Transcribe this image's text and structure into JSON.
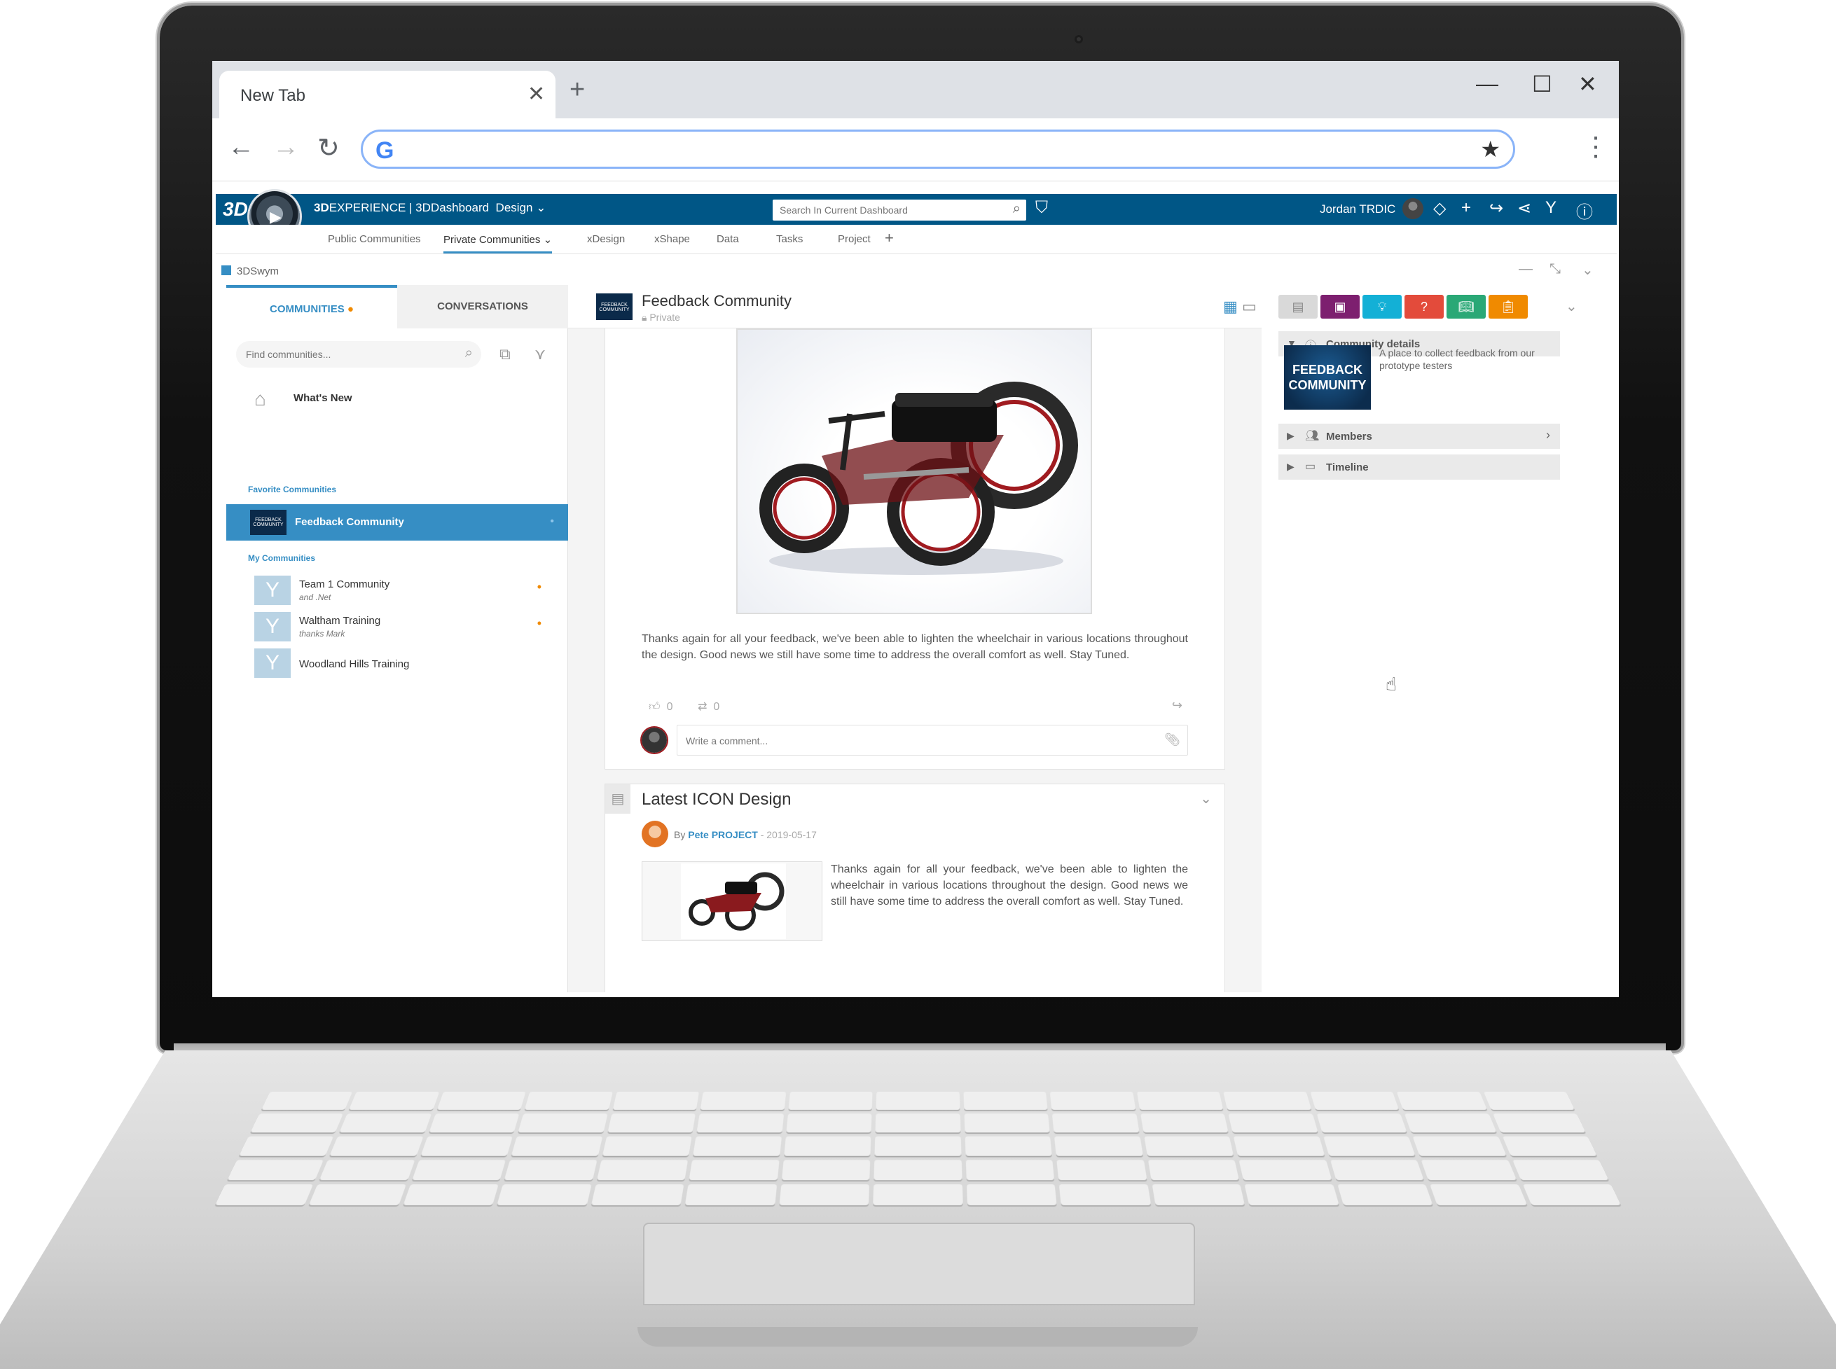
{
  "browser": {
    "tab_title": "New Tab",
    "tab_close": "✕",
    "new_tab": "+",
    "omnibox_value": "",
    "omnibox_logo": "G"
  },
  "xbar": {
    "brand_bold": "3D",
    "brand_text": "EXPERIENCE | 3DDashboard",
    "brand_app": "Design",
    "search_placeholder": "Search In Current Dashboard",
    "user_name": "Jordan TRDIC"
  },
  "dashboard_tabs": [
    {
      "label": "Public Communities"
    },
    {
      "label": "Private Communities"
    },
    {
      "label": "xDesign"
    },
    {
      "label": "xShape"
    },
    {
      "label": "Data"
    },
    {
      "label": "Tasks"
    },
    {
      "label": "Project"
    }
  ],
  "widget": {
    "title": "3DSwym"
  },
  "sidebar": {
    "tab_communities": "COMMUNITIES",
    "tab_conversations": "CONVERSATIONS",
    "find_placeholder": "Find communities...",
    "whats_new": "What's New",
    "favorites_label": "Favorite Communities",
    "favorite": {
      "name": "Feedback Community",
      "thumb_text": "FEEDBACK COMMUNITY"
    },
    "my_label": "My Communities",
    "communities": [
      {
        "name": "Team 1 Community",
        "sub": "and .Net"
      },
      {
        "name": "Waltham Training",
        "sub": "thanks Mark"
      },
      {
        "name": "Woodland Hills Training",
        "sub": ""
      }
    ]
  },
  "feed": {
    "title": "Feedback Community",
    "privacy": "Private",
    "thumb_text": "FEEDBACK COMMUNITY",
    "post1": {
      "text": "Thanks again for all your feedback, we've been able to lighten the wheelchair in various locations throughout the design. Good news we still have some time to address the overall comfort as well. Stay Tuned.",
      "likes": "0",
      "reposts": "0",
      "comment_placeholder": "Write a comment..."
    },
    "post2": {
      "title": "Latest ICON Design",
      "by": "By",
      "author": "Pete PROJECT",
      "date": "- 2019-05-17",
      "text": "Thanks again for all your feedback, we've been able to lighten the wheelchair in various locations throughout the design. Good news we still have some time to address the overall comfort as well. Stay Tuned."
    }
  },
  "right_panel": {
    "tiles": [
      {
        "color": "#d9d9d9"
      },
      {
        "color": "#7d1f6f"
      },
      {
        "color": "#13b0d6"
      },
      {
        "color": "#e34b3b"
      },
      {
        "color": "#2aa876"
      },
      {
        "color": "#f08a00"
      }
    ],
    "community_details": "Community details",
    "logo_text": "FEEDBACK COMMUNITY",
    "description": "A place to collect feedback from our prototype testers",
    "members": "Members",
    "timeline": "Timeline"
  },
  "colors": {
    "accent": "#368ec4",
    "topbar": "#005686",
    "notification": "#f08a00"
  }
}
